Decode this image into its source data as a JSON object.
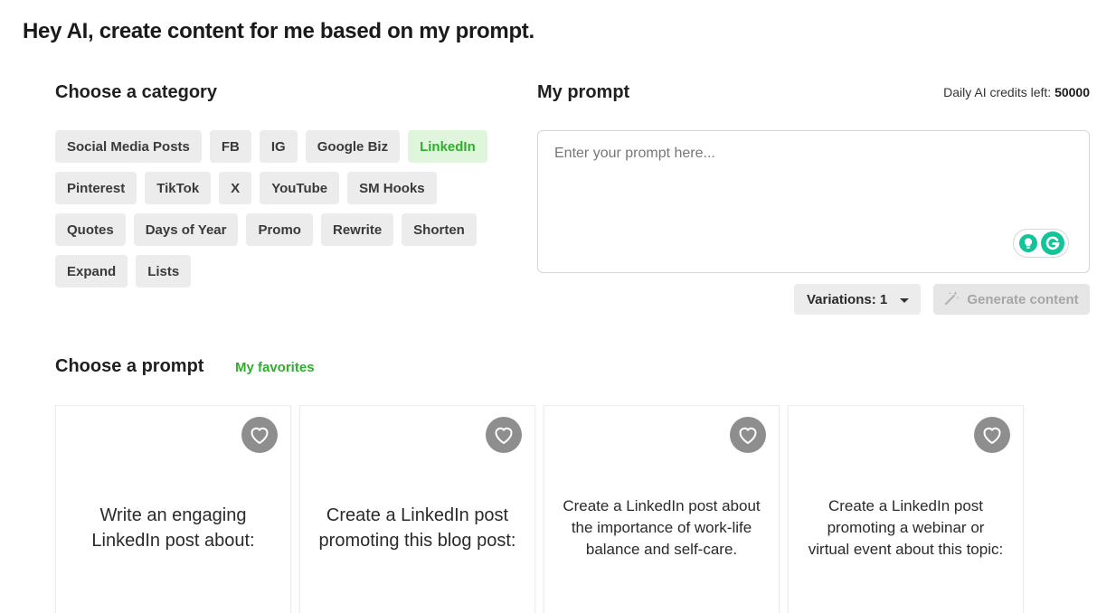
{
  "header": {
    "title": "Hey AI, create content for me based on my prompt."
  },
  "category": {
    "heading": "Choose a category",
    "chips": [
      {
        "label": "Social Media Posts",
        "active": false
      },
      {
        "label": "FB",
        "active": false
      },
      {
        "label": "IG",
        "active": false
      },
      {
        "label": "Google Biz",
        "active": false
      },
      {
        "label": "LinkedIn",
        "active": true
      },
      {
        "label": "Pinterest",
        "active": false
      },
      {
        "label": "TikTok",
        "active": false
      },
      {
        "label": "X",
        "active": false
      },
      {
        "label": "YouTube",
        "active": false
      },
      {
        "label": "SM Hooks",
        "active": false
      },
      {
        "label": "Quotes",
        "active": false
      },
      {
        "label": "Days of Year",
        "active": false
      },
      {
        "label": "Promo",
        "active": false
      },
      {
        "label": "Rewrite",
        "active": false
      },
      {
        "label": "Shorten",
        "active": false
      },
      {
        "label": "Expand",
        "active": false
      },
      {
        "label": "Lists",
        "active": false
      }
    ]
  },
  "prompt": {
    "heading": "My prompt",
    "credits_label": "Daily AI credits left:",
    "credits_value": "50000",
    "placeholder": "Enter your prompt here...",
    "value": "",
    "variations_label": "Variations: 1",
    "generate_label": "Generate content",
    "generate_enabled": false
  },
  "choose_prompt": {
    "heading": "Choose a prompt",
    "favorites_label": "My favorites",
    "cards": [
      {
        "text": "Write an engaging LinkedIn post about:",
        "size": "large"
      },
      {
        "text": "Create a LinkedIn post promoting this blog post:",
        "size": "large"
      },
      {
        "text": "Create a LinkedIn post about the importance of work-life balance and self-care.",
        "size": "small"
      },
      {
        "text": "Create a LinkedIn post promoting a webinar or virtual event about this topic:",
        "size": "small"
      }
    ]
  },
  "colors": {
    "accent": "#2fae2c",
    "accent_bg": "#dff5dc",
    "chip_bg": "#ececec",
    "heart_bg": "#8e8e8e",
    "grammarly": "#15c39a"
  },
  "icons": {
    "favorite": "heart-icon",
    "generate": "magic-wand-icon",
    "dropdown": "caret-down-icon",
    "grammarly": "grammarly-icon",
    "idea": "lightbulb-icon"
  }
}
